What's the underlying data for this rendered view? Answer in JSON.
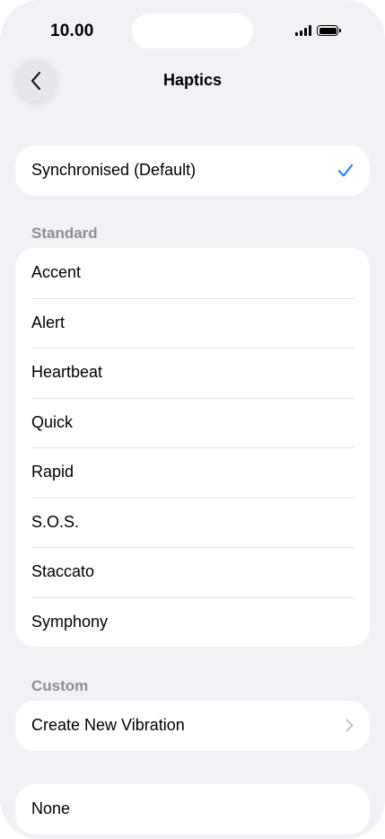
{
  "status_bar": {
    "time": "10.00"
  },
  "nav": {
    "title": "Haptics"
  },
  "default_group": {
    "label": "Synchronised (Default)",
    "selected": true
  },
  "standard": {
    "header": "Standard",
    "items": [
      "Accent",
      "Alert",
      "Heartbeat",
      "Quick",
      "Rapid",
      "S.O.S.",
      "Staccato",
      "Symphony"
    ]
  },
  "custom": {
    "header": "Custom",
    "create_label": "Create New Vibration"
  },
  "none_group": {
    "label": "None"
  },
  "colors": {
    "background": "#f2f2f6",
    "card": "#ffffff",
    "accent": "#1a84ff",
    "secondary_text": "#8e8e93"
  }
}
